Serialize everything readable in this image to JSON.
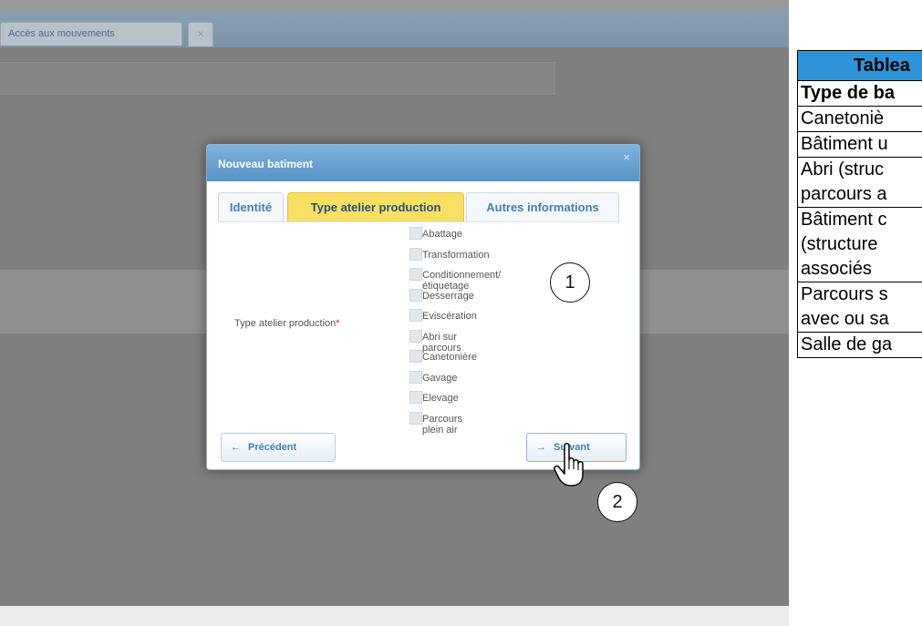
{
  "app": {
    "tabs": [
      {
        "label": "Accès aux mouvements"
      },
      {
        "label": "×"
      }
    ]
  },
  "modal": {
    "title": "Nouveau batiment",
    "close": "×",
    "tabs": [
      {
        "label": "Identité"
      },
      {
        "label": "Type atelier production"
      },
      {
        "label": "Autres informations"
      }
    ],
    "field_label": "Type atelier production",
    "required_mark": "*",
    "options": [
      {
        "label": "Abattage"
      },
      {
        "label": "Transformation"
      },
      {
        "label": "Conditionnement/étiquetage"
      },
      {
        "label": "Desserrage"
      },
      {
        "label": "Eviscération"
      },
      {
        "label": "Abri sur parcours"
      },
      {
        "label": "Canetonière"
      },
      {
        "label": "Gavage"
      },
      {
        "label": "Elevage"
      },
      {
        "label": "Parcours plein air"
      }
    ],
    "prev_button": "Précédent",
    "prev_arrow": "←",
    "next_button": "Suivant",
    "next_arrow": "→"
  },
  "callouts": {
    "c1": "1",
    "c2": "2"
  },
  "table": {
    "header": "Tablea",
    "subheader": "Type de ba",
    "rows": [
      [
        "Canetoniè"
      ],
      [
        "Bâtiment u"
      ],
      [
        "Abri (struc",
        "parcours a"
      ],
      [
        "Bâtiment c",
        "(structure",
        "associés"
      ],
      [
        "Parcours s",
        "avec ou sa"
      ],
      [
        "Salle de ga"
      ]
    ]
  }
}
